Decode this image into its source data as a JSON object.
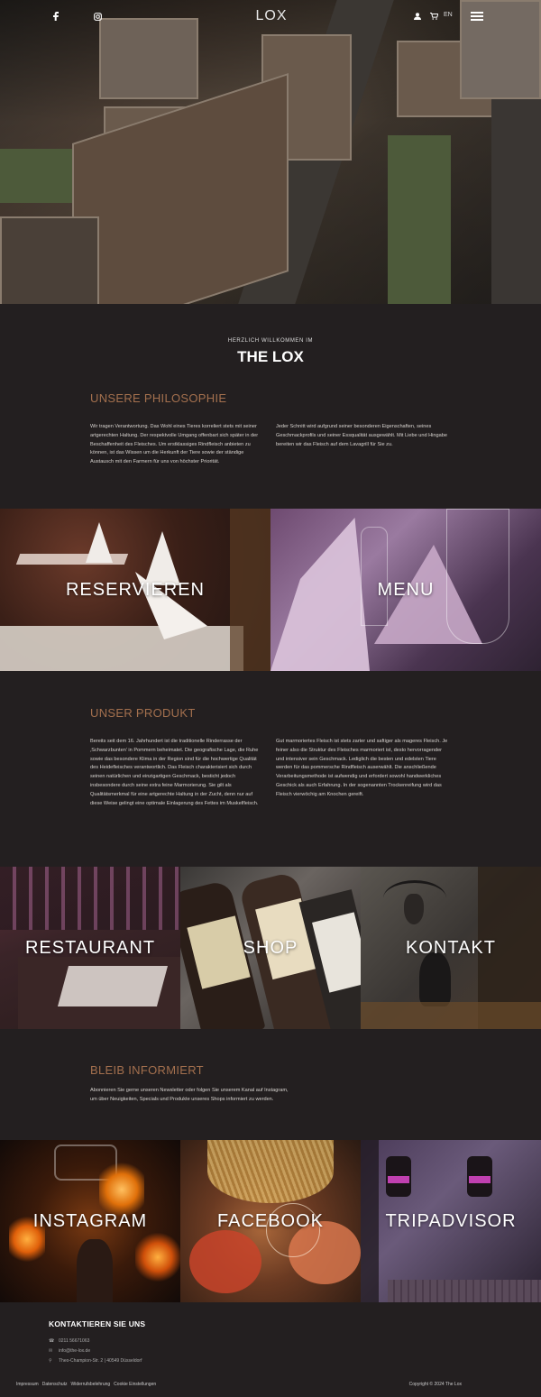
{
  "header": {
    "logo_text": "LOX",
    "lang": "EN",
    "icons": [
      "facebook-icon",
      "instagram-icon",
      "user-icon",
      "cart-icon",
      "menu-icon"
    ]
  },
  "welcome": {
    "kicker": "HERZLICH WILLKOMMEN IM",
    "title": "THE LOX"
  },
  "philosophy": {
    "heading": "UNSERE PHILOSOPHIE",
    "left": "Wir tragen Verantwortung. Das Wohl eines Tieres korreliert stets mit seiner artgerechten Haltung. Der respektvolle Umgang offenbart sich später in der Beschaffenheit des Fleisches. Um erstklassiges Rindfleisch anbieten zu können, ist das Wissen um die Herkunft der Tiere sowie der ständige Austausch mit den Farmern für uns von höchster Priorität.",
    "right": "Jeder Schnitt wird aufgrund seiner besonderen Eigenschaften, seines Geschmackprofils und seiner Essqualität ausgewählt. Mit Liebe und Hingabe bereiten wir das Fleisch auf dem Lavagrill für Sie zu."
  },
  "tiles_row1": [
    {
      "label": "RESERVIEREN"
    },
    {
      "label": "MENU"
    }
  ],
  "product": {
    "heading": "UNSER PRODUKT",
    "left": "Bereits seit dem 16. Jahrhundert ist die traditionelle Rinderrasse der ‚Schwarzbunten' in Pommern beheimatet. Die geografische Lage, die Ruhe sowie das besondere Klima in der Region sind für die hochwertige Qualität des Heidefleisches verantwortlich. Das Fleisch charakterisiert sich durch seinen natürlichen und einzigartigen Geschmack, besticht jedoch insbesondere durch seine extra feine Marmorierung. Sie gilt als Qualitätsmerkmal für eine artgerechte Haltung in der Zucht, denn nur auf diese Weise gelingt eine optimale Einlagerung des Fettes im Muskelfleisch.",
    "right": "Gut marmoriertes Fleisch ist stets zarter und saftiger als mageres Fleisch. Je feiner also die Struktur des Fleisches marmoriert ist, desto hervorragender und intensiver sein Geschmack. Lediglich die besten und edelsten Tiere werden für das pommersche Rindfleisch auserwählt. Die anschließende Verarbeitungsmethode ist aufwendig und erfordert sowohl handwerkliches Geschick als auch Erfahrung. In der sogenannten Trockenreifung wird das Fleisch vierwöchig am Knochen gereift."
  },
  "tiles_row2": [
    {
      "label": "RESTAURANT"
    },
    {
      "label": "SHOP"
    },
    {
      "label": "KONTAKT"
    }
  ],
  "newsletter": {
    "heading": "BLEIB INFORMIERT",
    "text": "Abonnieren Sie gerne unseren Newsletter oder folgen Sie unserem Kanal auf Instagram, um über Neuigkeiten, Specials und Produkte unseres Shops informiert zu werden."
  },
  "tiles_row3": [
    {
      "label": "INSTAGRAM"
    },
    {
      "label": "FACEBOOK"
    },
    {
      "label": "TRIPADVISOR"
    }
  ],
  "footer": {
    "heading": "KONTAKTIEREN SIE UNS",
    "phone": "0211 56671063",
    "email": "info@the-lox.de",
    "address": "Theo-Champion-Str. 2 | 40549 Düsseldorf",
    "links": [
      "Impressum",
      "Datenschutz",
      "Widerrufsbelehrung",
      "Cookie Einstellungen"
    ],
    "copyright": "Copyright © 2024 The Lox"
  }
}
